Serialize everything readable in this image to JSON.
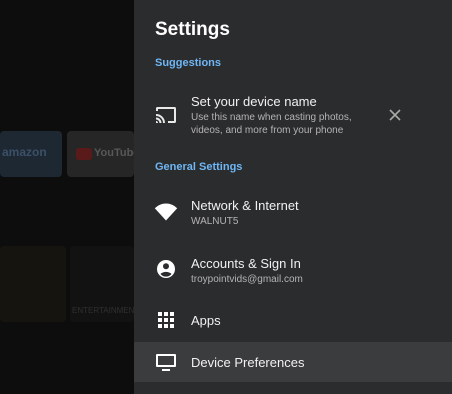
{
  "background": {
    "amazon_label": "amazon",
    "youtube_label": "YouTube",
    "thumb_caption": "ENTERTAINMENT"
  },
  "settings": {
    "title": "Settings",
    "suggestions_header": "Suggestions",
    "suggestion": {
      "label": "Set your device name",
      "description": "Use this name when casting photos, videos, and more from your phone",
      "icon": "cast-icon"
    },
    "general_header": "General Settings",
    "items": [
      {
        "label": "Network & Internet",
        "sub": "WALNUT5",
        "icon": "wifi-icon"
      },
      {
        "label": "Accounts & Sign In",
        "sub": "troypointvids@gmail.com",
        "icon": "account-icon"
      },
      {
        "label": "Apps",
        "sub": "",
        "icon": "apps-grid-icon"
      },
      {
        "label": "Device Preferences",
        "sub": "",
        "icon": "tv-icon"
      }
    ]
  },
  "colors": {
    "panel_bg": "#2b2c2e",
    "selected_bg": "#3b3c3e",
    "section_accent": "#6fb6f4"
  }
}
